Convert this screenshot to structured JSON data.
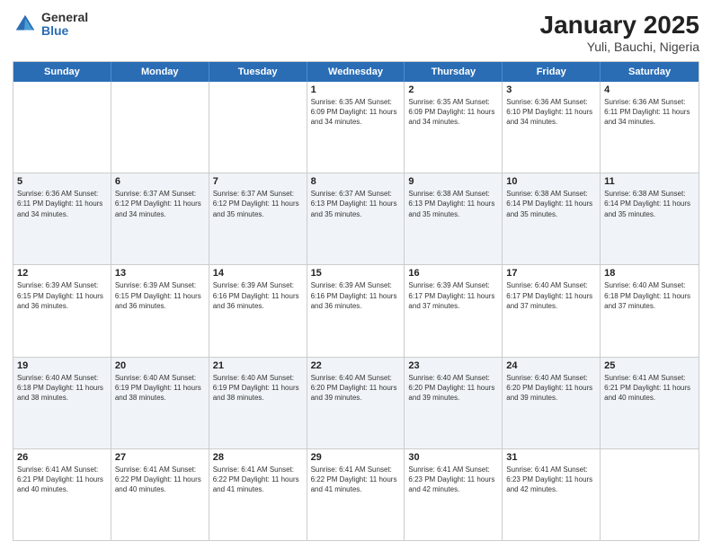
{
  "header": {
    "logo_general": "General",
    "logo_blue": "Blue",
    "title": "January 2025",
    "subtitle": "Yuli, Bauchi, Nigeria"
  },
  "days": [
    "Sunday",
    "Monday",
    "Tuesday",
    "Wednesday",
    "Thursday",
    "Friday",
    "Saturday"
  ],
  "weeks": [
    [
      {
        "day": "",
        "detail": ""
      },
      {
        "day": "",
        "detail": ""
      },
      {
        "day": "",
        "detail": ""
      },
      {
        "day": "1",
        "detail": "Sunrise: 6:35 AM\nSunset: 6:09 PM\nDaylight: 11 hours\nand 34 minutes."
      },
      {
        "day": "2",
        "detail": "Sunrise: 6:35 AM\nSunset: 6:09 PM\nDaylight: 11 hours\nand 34 minutes."
      },
      {
        "day": "3",
        "detail": "Sunrise: 6:36 AM\nSunset: 6:10 PM\nDaylight: 11 hours\nand 34 minutes."
      },
      {
        "day": "4",
        "detail": "Sunrise: 6:36 AM\nSunset: 6:11 PM\nDaylight: 11 hours\nand 34 minutes."
      }
    ],
    [
      {
        "day": "5",
        "detail": "Sunrise: 6:36 AM\nSunset: 6:11 PM\nDaylight: 11 hours\nand 34 minutes."
      },
      {
        "day": "6",
        "detail": "Sunrise: 6:37 AM\nSunset: 6:12 PM\nDaylight: 11 hours\nand 34 minutes."
      },
      {
        "day": "7",
        "detail": "Sunrise: 6:37 AM\nSunset: 6:12 PM\nDaylight: 11 hours\nand 35 minutes."
      },
      {
        "day": "8",
        "detail": "Sunrise: 6:37 AM\nSunset: 6:13 PM\nDaylight: 11 hours\nand 35 minutes."
      },
      {
        "day": "9",
        "detail": "Sunrise: 6:38 AM\nSunset: 6:13 PM\nDaylight: 11 hours\nand 35 minutes."
      },
      {
        "day": "10",
        "detail": "Sunrise: 6:38 AM\nSunset: 6:14 PM\nDaylight: 11 hours\nand 35 minutes."
      },
      {
        "day": "11",
        "detail": "Sunrise: 6:38 AM\nSunset: 6:14 PM\nDaylight: 11 hours\nand 35 minutes."
      }
    ],
    [
      {
        "day": "12",
        "detail": "Sunrise: 6:39 AM\nSunset: 6:15 PM\nDaylight: 11 hours\nand 36 minutes."
      },
      {
        "day": "13",
        "detail": "Sunrise: 6:39 AM\nSunset: 6:15 PM\nDaylight: 11 hours\nand 36 minutes."
      },
      {
        "day": "14",
        "detail": "Sunrise: 6:39 AM\nSunset: 6:16 PM\nDaylight: 11 hours\nand 36 minutes."
      },
      {
        "day": "15",
        "detail": "Sunrise: 6:39 AM\nSunset: 6:16 PM\nDaylight: 11 hours\nand 36 minutes."
      },
      {
        "day": "16",
        "detail": "Sunrise: 6:39 AM\nSunset: 6:17 PM\nDaylight: 11 hours\nand 37 minutes."
      },
      {
        "day": "17",
        "detail": "Sunrise: 6:40 AM\nSunset: 6:17 PM\nDaylight: 11 hours\nand 37 minutes."
      },
      {
        "day": "18",
        "detail": "Sunrise: 6:40 AM\nSunset: 6:18 PM\nDaylight: 11 hours\nand 37 minutes."
      }
    ],
    [
      {
        "day": "19",
        "detail": "Sunrise: 6:40 AM\nSunset: 6:18 PM\nDaylight: 11 hours\nand 38 minutes."
      },
      {
        "day": "20",
        "detail": "Sunrise: 6:40 AM\nSunset: 6:19 PM\nDaylight: 11 hours\nand 38 minutes."
      },
      {
        "day": "21",
        "detail": "Sunrise: 6:40 AM\nSunset: 6:19 PM\nDaylight: 11 hours\nand 38 minutes."
      },
      {
        "day": "22",
        "detail": "Sunrise: 6:40 AM\nSunset: 6:20 PM\nDaylight: 11 hours\nand 39 minutes."
      },
      {
        "day": "23",
        "detail": "Sunrise: 6:40 AM\nSunset: 6:20 PM\nDaylight: 11 hours\nand 39 minutes."
      },
      {
        "day": "24",
        "detail": "Sunrise: 6:40 AM\nSunset: 6:20 PM\nDaylight: 11 hours\nand 39 minutes."
      },
      {
        "day": "25",
        "detail": "Sunrise: 6:41 AM\nSunset: 6:21 PM\nDaylight: 11 hours\nand 40 minutes."
      }
    ],
    [
      {
        "day": "26",
        "detail": "Sunrise: 6:41 AM\nSunset: 6:21 PM\nDaylight: 11 hours\nand 40 minutes."
      },
      {
        "day": "27",
        "detail": "Sunrise: 6:41 AM\nSunset: 6:22 PM\nDaylight: 11 hours\nand 40 minutes."
      },
      {
        "day": "28",
        "detail": "Sunrise: 6:41 AM\nSunset: 6:22 PM\nDaylight: 11 hours\nand 41 minutes."
      },
      {
        "day": "29",
        "detail": "Sunrise: 6:41 AM\nSunset: 6:22 PM\nDaylight: 11 hours\nand 41 minutes."
      },
      {
        "day": "30",
        "detail": "Sunrise: 6:41 AM\nSunset: 6:23 PM\nDaylight: 11 hours\nand 42 minutes."
      },
      {
        "day": "31",
        "detail": "Sunrise: 6:41 AM\nSunset: 6:23 PM\nDaylight: 11 hours\nand 42 minutes."
      },
      {
        "day": "",
        "detail": ""
      }
    ]
  ]
}
